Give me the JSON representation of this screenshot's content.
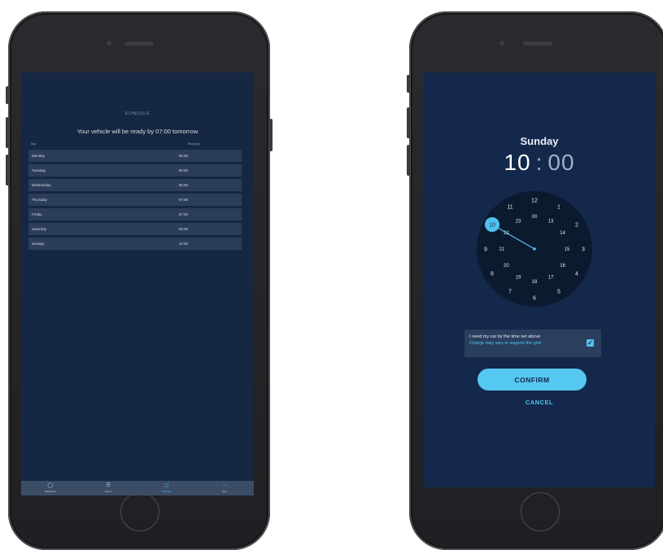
{
  "schedule_screen": {
    "title": "SCHEDULE",
    "ready_message": "Your vehicle will be ready by 07:00 tomorrow",
    "columns": {
      "day": "Day",
      "ready_by": "Ready by"
    },
    "rows": [
      {
        "day": "Monday",
        "time": "06:50"
      },
      {
        "day": "Tuesday",
        "time": "06:50"
      },
      {
        "day": "Wednesday",
        "time": "06:50"
      },
      {
        "day": "Thursday",
        "time": "07:00"
      },
      {
        "day": "Friday",
        "time": "07:00"
      },
      {
        "day": "Saturday",
        "time": "09:30"
      },
      {
        "day": "Sunday",
        "time": "10:00"
      }
    ],
    "tabs": [
      {
        "label": "Dashboard",
        "icon": "clock-icon"
      },
      {
        "label": "History",
        "icon": "history-icon"
      },
      {
        "label": "Schedule",
        "icon": "schedule-icon",
        "active": true
      },
      {
        "label": "More",
        "icon": "more-icon"
      }
    ]
  },
  "time_picker_screen": {
    "day": "Sunday",
    "hours": "10",
    "separator": ":",
    "minutes": "00",
    "outer_numbers": [
      "12",
      "1",
      "2",
      "3",
      "4",
      "5",
      "6",
      "7",
      "8",
      "9",
      "10",
      "11"
    ],
    "inner_numbers": [
      "00",
      "13",
      "14",
      "15",
      "16",
      "17",
      "18",
      "19",
      "20",
      "21",
      "22",
      "23"
    ],
    "selected_hour": "10",
    "option_line_1": "I need my car by the time set above",
    "option_line_2": "Charge may vary to support the grid",
    "option_checked": true,
    "confirm_label": "CONFIRM",
    "cancel_label": "CANCEL"
  },
  "colors": {
    "screen_bg": "#152742",
    "row_bg": "#2b3d58",
    "accent": "#4fc3ef",
    "clock_face": "#0c1a2f"
  }
}
